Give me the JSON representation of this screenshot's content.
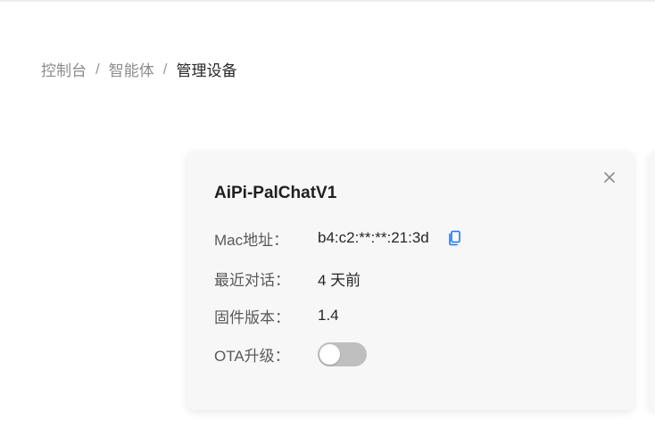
{
  "breadcrumb": {
    "items": [
      "控制台",
      "智能体",
      "管理设备"
    ],
    "separator": "/"
  },
  "device_card": {
    "title": "AiPi-PalChatV1",
    "mac": {
      "label": "Mac地址：",
      "value": "b4:c2:**:**:21:3d"
    },
    "last_chat": {
      "label": "最近对话：",
      "value": "4 天前"
    },
    "firmware": {
      "label": "固件版本：",
      "value": "1.4"
    },
    "ota": {
      "label": "OTA升级：",
      "enabled": false
    }
  },
  "icons": {
    "close": "close-icon",
    "copy": "copy-icon"
  },
  "colors": {
    "accent": "#1677ff",
    "toggle_off": "#bfbfbf",
    "card_bg": "#f7f7f7"
  }
}
